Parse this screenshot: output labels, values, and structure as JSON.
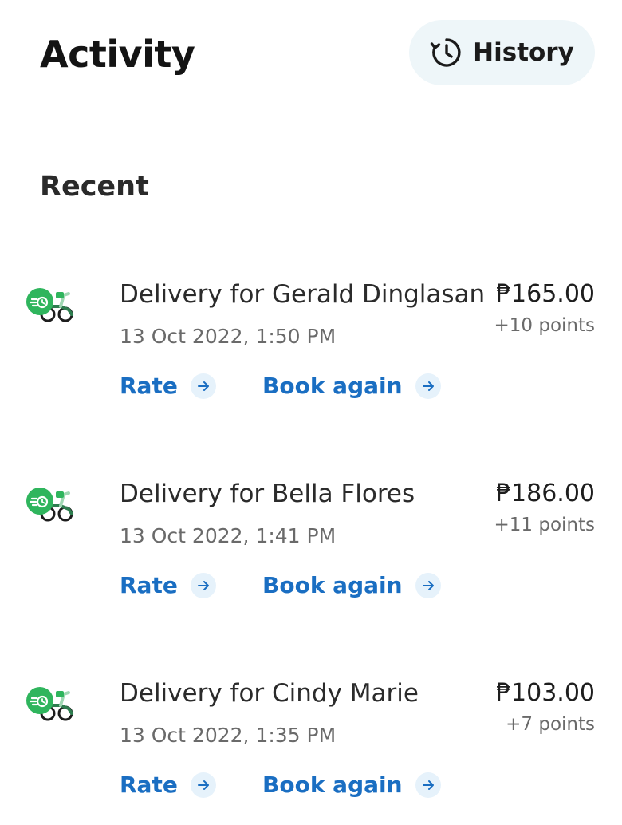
{
  "header": {
    "title": "Activity",
    "history_label": "History"
  },
  "section": {
    "title": "Recent"
  },
  "colors": {
    "accent_blue": "#1a6ec2",
    "brand_green": "#2fb55d",
    "history_bg": "#eef6f9"
  },
  "activities": [
    {
      "title": "Delivery for Gerald Dinglasan",
      "date": "13 Oct 2022, 1:50 PM",
      "amount": "₱165.00",
      "points": "+10 points",
      "rate_label": "Rate",
      "book_again_label": "Book again",
      "icon": "delivery-scooter-icon"
    },
    {
      "title": "Delivery for Bella Flores",
      "date": "13 Oct 2022, 1:41 PM",
      "amount": "₱186.00",
      "points": "+11 points",
      "rate_label": "Rate",
      "book_again_label": "Book again",
      "icon": "delivery-scooter-icon"
    },
    {
      "title": "Delivery for Cindy Marie",
      "date": "13 Oct 2022, 1:35 PM",
      "amount": "₱103.00",
      "points": "+7 points",
      "rate_label": "Rate",
      "book_again_label": "Book again",
      "icon": "delivery-scooter-icon"
    }
  ]
}
